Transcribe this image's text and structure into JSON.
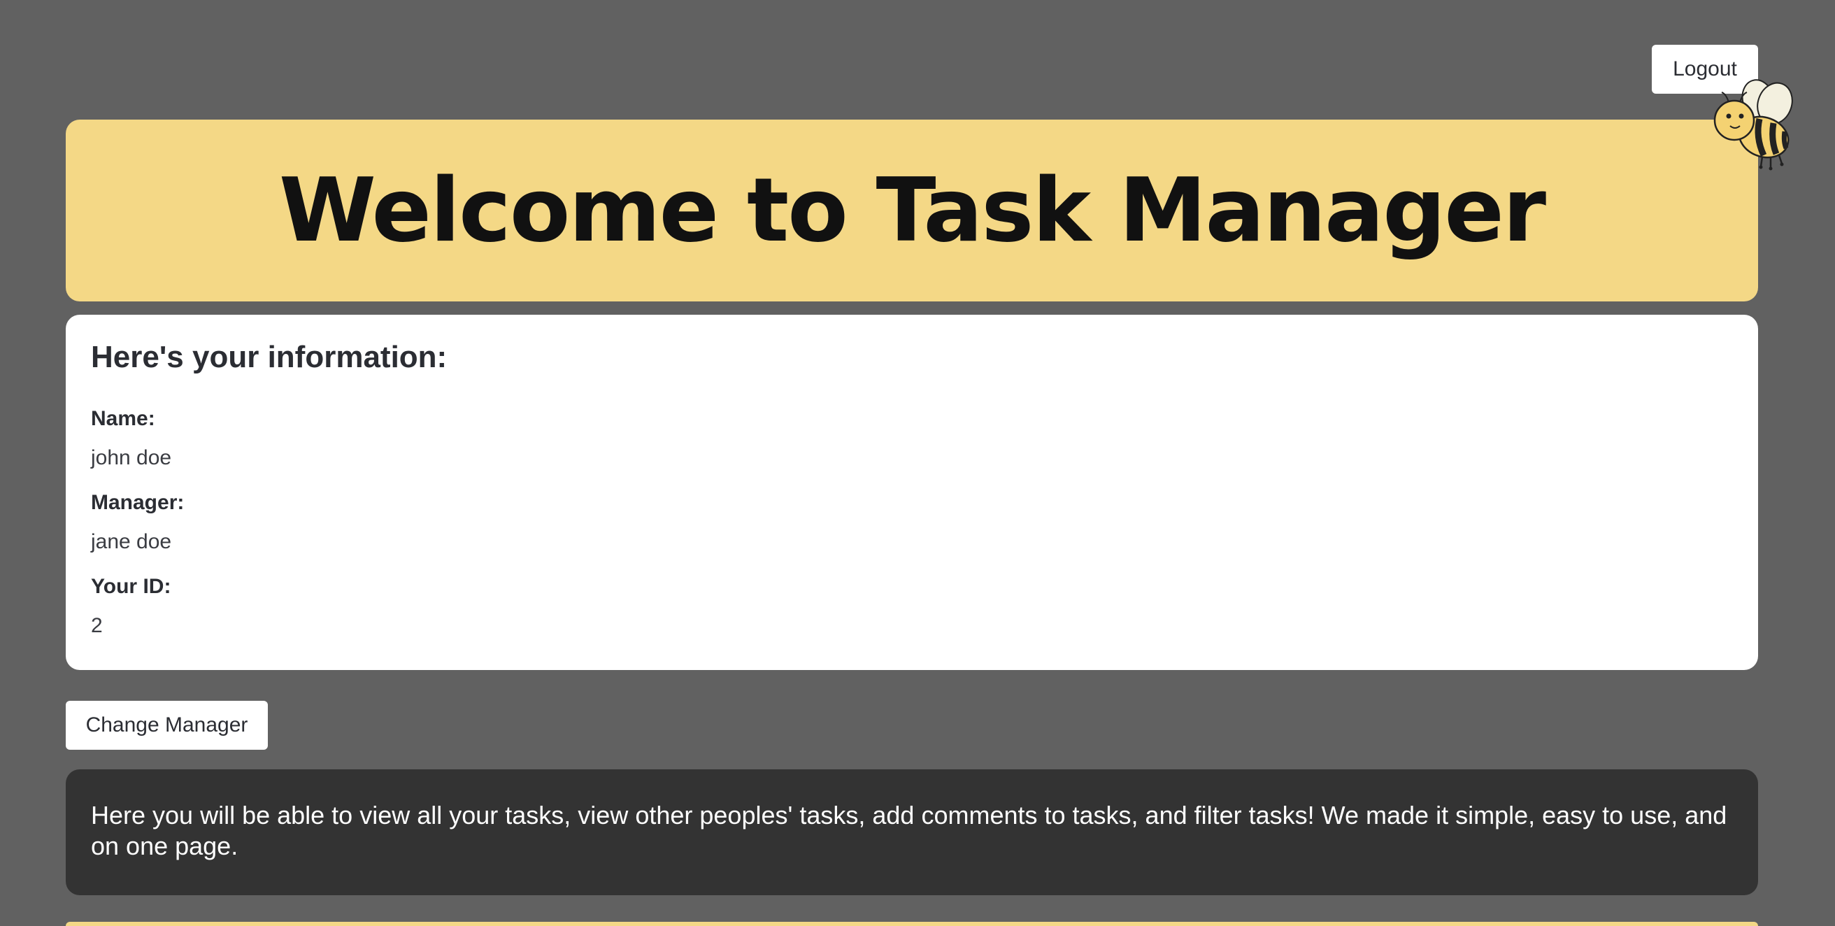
{
  "header": {
    "logout_label": "Logout",
    "title": "Welcome to Task Manager",
    "mascot_icon": "bee-icon"
  },
  "info": {
    "heading": "Here's your information:",
    "fields": [
      {
        "label": "Name:",
        "value": "john doe"
      },
      {
        "label": "Manager:",
        "value": "jane doe"
      },
      {
        "label": "Your ID:",
        "value": "2"
      }
    ]
  },
  "actions": {
    "change_manager_label": "Change Manager"
  },
  "intro": {
    "text": "Here you will be able to view all your tasks, view other peoples' tasks, add comments to tasks, and filter tasks! We made it simple, easy to use, and on one page."
  },
  "colors": {
    "background": "#616161",
    "banner": "#f4d886",
    "card": "#ffffff",
    "intro_box": "#333333"
  }
}
